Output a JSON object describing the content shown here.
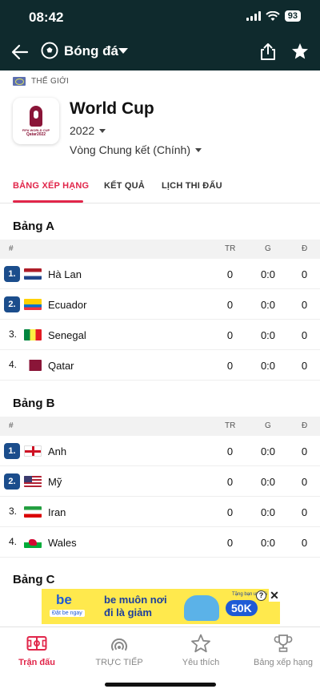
{
  "status_bar": {
    "time": "08:42",
    "battery": "93"
  },
  "nav": {
    "title": "Bóng đá"
  },
  "league": {
    "region": "THẾ GIỚI",
    "logo_text_1": "FIFA WORLD CUP",
    "logo_text_2": "Qatar2022",
    "name": "World Cup",
    "season": "2022",
    "stage": "Vòng Chung kết (Chính)"
  },
  "tabs": [
    {
      "label": "BẢNG XẾP HẠNG",
      "active": true
    },
    {
      "label": "KẾT QUẢ",
      "active": false
    },
    {
      "label": "LỊCH THI ĐẤU",
      "active": false
    }
  ],
  "table_headers": {
    "rank": "#",
    "played": "TR",
    "goals": "G",
    "points": "Đ"
  },
  "groups": [
    {
      "title": "Bảng A",
      "rows": [
        {
          "rank": "1.",
          "team": "Hà Lan",
          "flag": "netherlands-flag",
          "played": "0",
          "goals": "0:0",
          "points": "0"
        },
        {
          "rank": "2.",
          "team": "Ecuador",
          "flag": "ecuador-flag",
          "played": "0",
          "goals": "0:0",
          "points": "0"
        },
        {
          "rank": "3.",
          "team": "Senegal",
          "flag": "senegal-flag",
          "played": "0",
          "goals": "0:0",
          "points": "0"
        },
        {
          "rank": "4.",
          "team": "Qatar",
          "flag": "qatar-flag",
          "played": "0",
          "goals": "0:0",
          "points": "0"
        }
      ]
    },
    {
      "title": "Bảng B",
      "rows": [
        {
          "rank": "1.",
          "team": "Anh",
          "flag": "england-flag",
          "played": "0",
          "goals": "0:0",
          "points": "0"
        },
        {
          "rank": "2.",
          "team": "Mỹ",
          "flag": "usa-flag",
          "played": "0",
          "goals": "0:0",
          "points": "0"
        },
        {
          "rank": "3.",
          "team": "Iran",
          "flag": "iran-flag",
          "played": "0",
          "goals": "0:0",
          "points": "0"
        },
        {
          "rank": "4.",
          "team": "Wales",
          "flag": "wales-flag",
          "played": "0",
          "goals": "0:0",
          "points": "0"
        }
      ]
    },
    {
      "title": "Bảng C"
    }
  ],
  "ad": {
    "brand": "be",
    "brand_sub": "Đặt be ngay",
    "slogan_1": "be muôn nơi",
    "slogan_2": "đi là giảm",
    "promo_top": "Tặng bạn ưu đãi",
    "promo": "50K",
    "info": "?",
    "close": "✕"
  },
  "tabbar": [
    {
      "label": "Trận đấu",
      "icon": "pitch-icon",
      "active": true
    },
    {
      "label": "TRỰC TIẾP",
      "icon": "live-icon",
      "active": false
    },
    {
      "label": "Yêu thích",
      "icon": "star-icon",
      "active": false
    },
    {
      "label": "Bảng xếp hạng",
      "icon": "trophy-icon",
      "active": false
    }
  ],
  "colors": {
    "header_bg": "#0f2a2d",
    "accent": "#e1264a",
    "rank_badge": "#1b4d8c"
  }
}
